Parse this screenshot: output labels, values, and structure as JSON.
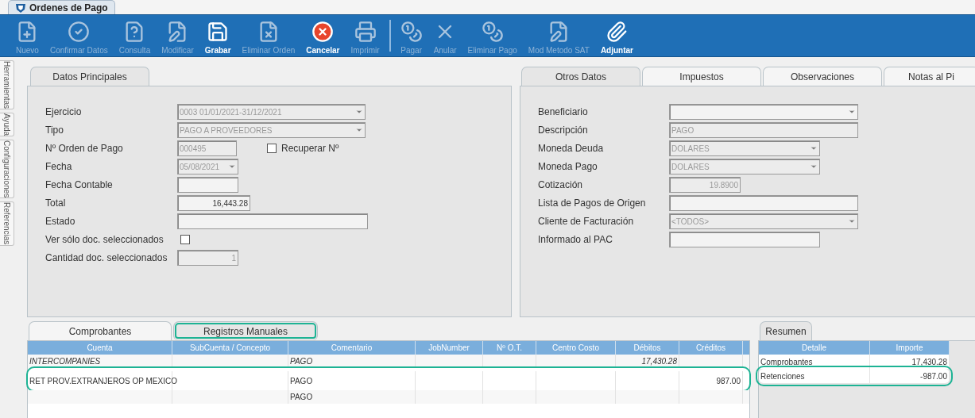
{
  "window": {
    "title": "Ordenes de Pago"
  },
  "toolbar": [
    {
      "label": "Nuevo",
      "disabled": true
    },
    {
      "label": "Confirmar Datos",
      "disabled": true
    },
    {
      "label": "Consulta",
      "disabled": true
    },
    {
      "label": "Modificar",
      "disabled": true
    },
    {
      "label": "Grabar",
      "disabled": false
    },
    {
      "label": "Eliminar Orden",
      "disabled": true
    },
    {
      "label": "Cancelar",
      "disabled": false
    },
    {
      "label": "Imprimir",
      "disabled": true
    },
    {
      "label": "Pagar",
      "disabled": true,
      "separator_before": true
    },
    {
      "label": "Anular",
      "disabled": true
    },
    {
      "label": "Eliminar Pago",
      "disabled": true
    },
    {
      "label": "Mod Metodo SAT",
      "disabled": true
    },
    {
      "label": "Adjuntar",
      "disabled": false
    }
  ],
  "side_tabs": [
    "Herramientas",
    "Ayuda",
    "Configuraciones",
    "Referencias"
  ],
  "left_panel": {
    "tabs": [
      {
        "label": "Datos Principales",
        "selected": true
      }
    ],
    "fields": [
      {
        "label": "Ejercicio",
        "kind": "select",
        "value": "0003 01/01/2021-31/12/2021",
        "disabled": true
      },
      {
        "label": "Tipo",
        "kind": "select",
        "value": "PAGO A PROVEEDORES",
        "disabled": true
      },
      {
        "label": "Nº Orden de Pago",
        "kind": "text",
        "value": "000495",
        "disabled": true,
        "extra": {
          "label": "Recuperar Nº",
          "checked": false
        }
      },
      {
        "label": "Fecha",
        "kind": "select",
        "value": "05/08/2021",
        "disabled": true
      },
      {
        "label": "Fecha Contable",
        "kind": "text"
      },
      {
        "label": "Total",
        "kind": "number",
        "value": "16,443.28",
        "disabled": false
      },
      {
        "label": "Estado",
        "kind": "text"
      },
      {
        "label": "Ver sólo doc. seleccionados",
        "kind": "checkbox",
        "checked": false
      },
      {
        "label": "Cantidad doc. seleccionados",
        "kind": "number",
        "value": "1",
        "disabled": true
      }
    ]
  },
  "right_panel": {
    "tabs": [
      {
        "label": "Otros Datos",
        "selected": true
      },
      {
        "label": "Impuestos",
        "selected": false
      },
      {
        "label": "Observaciones",
        "selected": false
      },
      {
        "label": "Notas al Pi",
        "selected": false
      }
    ],
    "fields": [
      {
        "label": "Beneficiario",
        "kind": "select"
      },
      {
        "label": "Descripción",
        "kind": "text",
        "value": "PAGO",
        "disabled": true
      },
      {
        "label": "Moneda Deuda",
        "kind": "select",
        "value": "DOLARES",
        "disabled": true
      },
      {
        "label": "Moneda Pago",
        "kind": "select",
        "value": "DOLARES",
        "disabled": true
      },
      {
        "label": "Cotización",
        "kind": "number",
        "value": "19.8900",
        "disabled": true
      },
      {
        "label": "Lista de Pagos de Origen",
        "kind": "text"
      },
      {
        "label": "Cliente de Facturación",
        "kind": "select",
        "value": "<TODOS>",
        "disabled": true
      },
      {
        "label": "Informado al PAC",
        "kind": "text"
      }
    ]
  },
  "detail": {
    "tabs": [
      {
        "label": "Comprobantes",
        "selected": false,
        "highlighted": false
      },
      {
        "label": "Registros Manuales",
        "selected": true,
        "highlighted": true
      }
    ],
    "table": {
      "columns": [
        "Cuenta",
        "SubCuenta / Concepto",
        "Comentario",
        "JobNumber",
        "Nº O.T.",
        "Centro Costo",
        "Débitos",
        "Créditos"
      ],
      "rows": [
        {
          "cells": [
            "INTERCOMPANIES",
            "",
            "PAGO",
            "",
            "",
            "",
            "17,430.28",
            ""
          ],
          "italic": true,
          "highlighted": false
        },
        {
          "cells": [
            "RET PROV.EXTRANJEROS OP MEXICO",
            "",
            "PAGO",
            "",
            "",
            "",
            "",
            "987.00"
          ],
          "italic": false,
          "highlighted": true
        },
        {
          "cells": [
            "",
            "",
            "PAGO",
            "",
            "",
            "",
            "",
            ""
          ],
          "italic": false,
          "highlighted": false
        }
      ]
    }
  },
  "summary": {
    "tabs": [
      {
        "label": "Resumen",
        "selected": true
      }
    ],
    "table": {
      "columns": [
        "Detalle",
        "Importe"
      ],
      "rows": [
        {
          "cells": [
            "Comprobantes",
            "17,430.28"
          ],
          "highlighted": false
        },
        {
          "cells": [
            "Retenciones",
            "-987.00"
          ],
          "highlighted": true
        }
      ]
    }
  }
}
